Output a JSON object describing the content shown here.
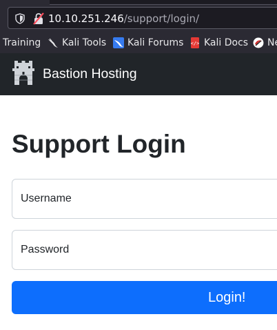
{
  "browser": {
    "url_host": "10.10.251.246",
    "url_path": "/support/login/",
    "icons": {
      "tracking": "shield-icon",
      "insecure": "insecure-lock-icon"
    },
    "bookmarks": [
      {
        "label": "Training",
        "icon": ""
      },
      {
        "label": "Kali Tools",
        "icon": "kali-dragon-icon"
      },
      {
        "label": "Kali Forums",
        "icon": "kali-forums-icon"
      },
      {
        "label": "Kali Docs",
        "icon": "kali-docs-icon"
      },
      {
        "label": "Ne",
        "icon": "netHunter-icon"
      }
    ]
  },
  "navbar": {
    "brand": "Bastion Hosting",
    "logo_icon": "castle-icon",
    "background": "#212529"
  },
  "page": {
    "title": "Support Login",
    "username_placeholder": "Username",
    "password_placeholder": "Password",
    "login_label": "Login!",
    "accent": "#0d6efd"
  }
}
